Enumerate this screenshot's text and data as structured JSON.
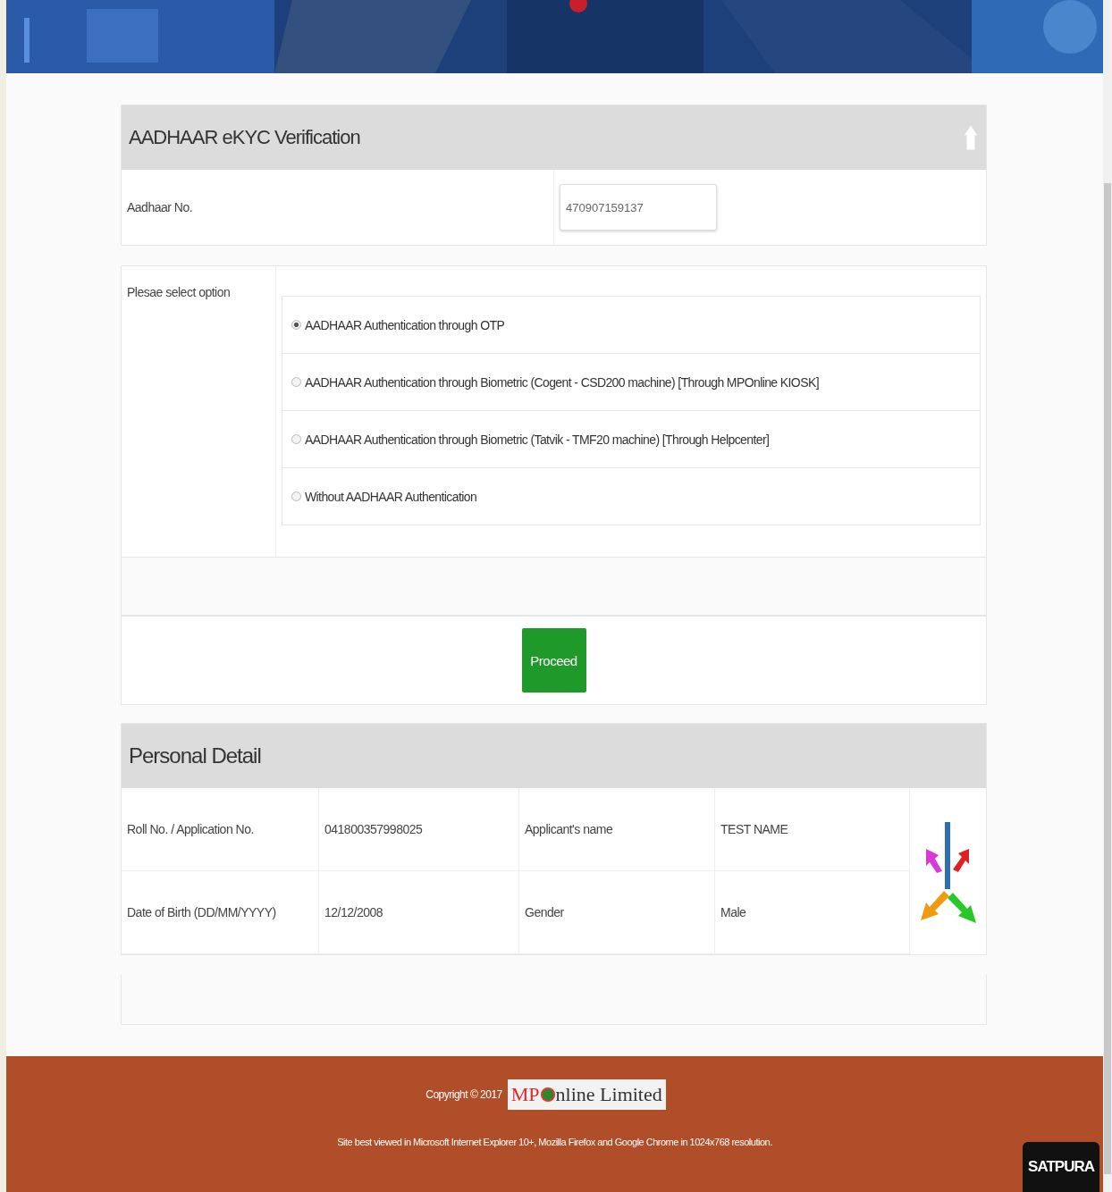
{
  "ekyc": {
    "title": "AADHAAR eKYC Verification",
    "aadhaar_label": "Aadhaar No.",
    "aadhaar_value": "470907159137",
    "option_label": "Plesae select option",
    "options": [
      {
        "label": "AADHAAR Authentication through OTP",
        "selected": true
      },
      {
        "label": "AADHAAR Authentication through Biometric (Cogent - CSD200 machine) [Through MPOnline KIOSK]",
        "selected": false
      },
      {
        "label": "AADHAAR Authentication through Biometric (Tatvik - TMF20 machine) [Through Helpcenter]",
        "selected": false
      },
      {
        "label": "Without AADHAAR Authentication",
        "selected": false
      }
    ],
    "proceed": "Proceed"
  },
  "personal": {
    "title": "Personal Detail",
    "rows": [
      [
        "Roll No. / Application No.",
        "041800357998025",
        "Applicant's name",
        "TEST NAME"
      ],
      [
        "Date of Birth (DD/MM/YYYY)",
        "12/12/2008",
        "Gender",
        "Male"
      ]
    ]
  },
  "footer": {
    "copyright": "Copyright © 2017",
    "logo_mp": "MP",
    "logo_rest": "nline Limited",
    "note": "Site best viewed in Microsoft Internet Explorer 10+, Mozilla Firefox and Google Chrome in 1024x768 resolution.",
    "badge": "SATPURA"
  }
}
